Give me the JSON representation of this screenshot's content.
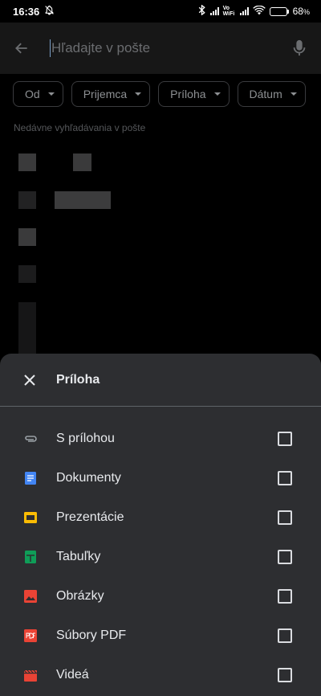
{
  "status_bar": {
    "time": "16:36",
    "vowifi": "Vo WiFi",
    "battery": "68",
    "battery_unit": "%",
    "battery_level": 0.68
  },
  "search": {
    "placeholder": "Hľadajte v pošte"
  },
  "filter_chips": [
    "Od",
    "Prijemca",
    "Príloha",
    "Dátum"
  ],
  "recent": {
    "title": "Nedávne vyhľadávania v pošte"
  },
  "sheet": {
    "title": "Príloha",
    "options": [
      {
        "label": "S prílohou",
        "icon": "paperclip-icon",
        "color": "#9aa0a6",
        "checked": false
      },
      {
        "label": "Dokumenty",
        "icon": "docs-icon",
        "color": "#4285f4",
        "checked": false
      },
      {
        "label": "Prezentácie",
        "icon": "slides-icon",
        "color": "#fbbc04",
        "checked": false
      },
      {
        "label": "Tabuľky",
        "icon": "sheets-icon",
        "color": "#0f9d58",
        "checked": false
      },
      {
        "label": "Obrázky",
        "icon": "image-icon",
        "color": "#ea4335",
        "checked": false
      },
      {
        "label": "Súbory PDF",
        "icon": "pdf-icon",
        "color": "#ea4335",
        "checked": false
      },
      {
        "label": "Videá",
        "icon": "video-icon",
        "color": "#ea4335",
        "checked": false
      }
    ]
  }
}
